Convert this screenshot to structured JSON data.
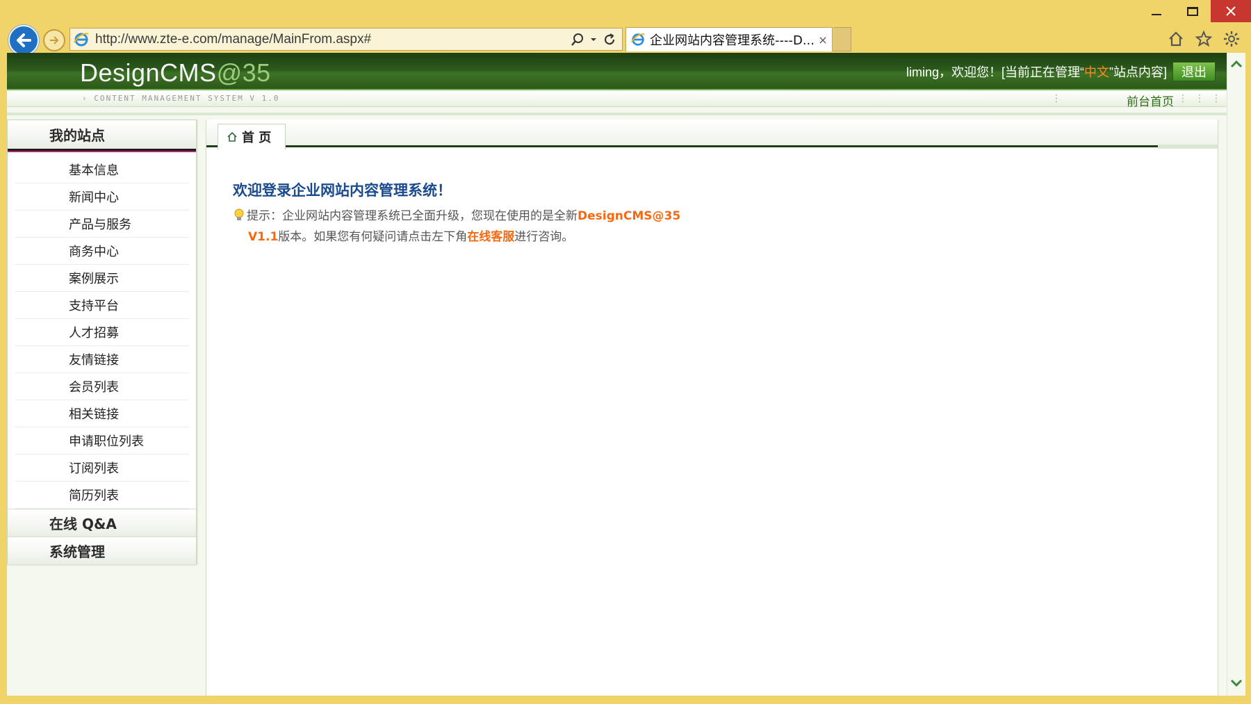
{
  "browser": {
    "url": "http://www.zte-e.com/manage/MainFrom.aspx#",
    "tab_title": "企业网站内容管理系统----D...",
    "tab_close": "×"
  },
  "header": {
    "logo_main": "DesignCMS",
    "logo_at": "@35",
    "subtitle": "› CONTENT MANAGEMENT SYSTEM V 1.0",
    "user_prefix": "liming，欢迎您！[当前正在管理“",
    "site_lang": "中文",
    "user_suffix": "”站点内容]",
    "logout_label": "退出",
    "front_link": "前台首页"
  },
  "sidebar": {
    "group1": "我的站点",
    "items": [
      "基本信息",
      "新闻中心",
      "产品与服务",
      "商务中心",
      "案例展示",
      "支持平台",
      "人才招募",
      "友情链接",
      "会员列表",
      "相关链接",
      "申请职位列表",
      "订阅列表",
      "简历列表"
    ],
    "group2": "在线 Q&A",
    "group3": "系统管理"
  },
  "main": {
    "tab_label": "首 页",
    "welcome": "欢迎登录企业网站内容管理系统！",
    "tip_prefix": "提示：企业网站内容管理系统已全面升级，您现在使用的是全新",
    "tip_product": "DesignCMS@35",
    "tip_version": "V1.1",
    "tip_middle": "版本。如果您有何疑问请点击左下角",
    "tip_link": "在线客服",
    "tip_suffix": "进行咨询。"
  },
  "colors": {
    "header_green": "#2c5a1c",
    "accent_orange": "#f36a12",
    "welcome_blue": "#1a4a8e",
    "browser_frame": "#f0d469"
  },
  "icons": [
    "back-arrow-icon",
    "forward-arrow-icon",
    "ie-page-icon",
    "search-icon",
    "refresh-icon",
    "home-icon",
    "star-icon",
    "gear-icon",
    "lightbulb-icon"
  ]
}
